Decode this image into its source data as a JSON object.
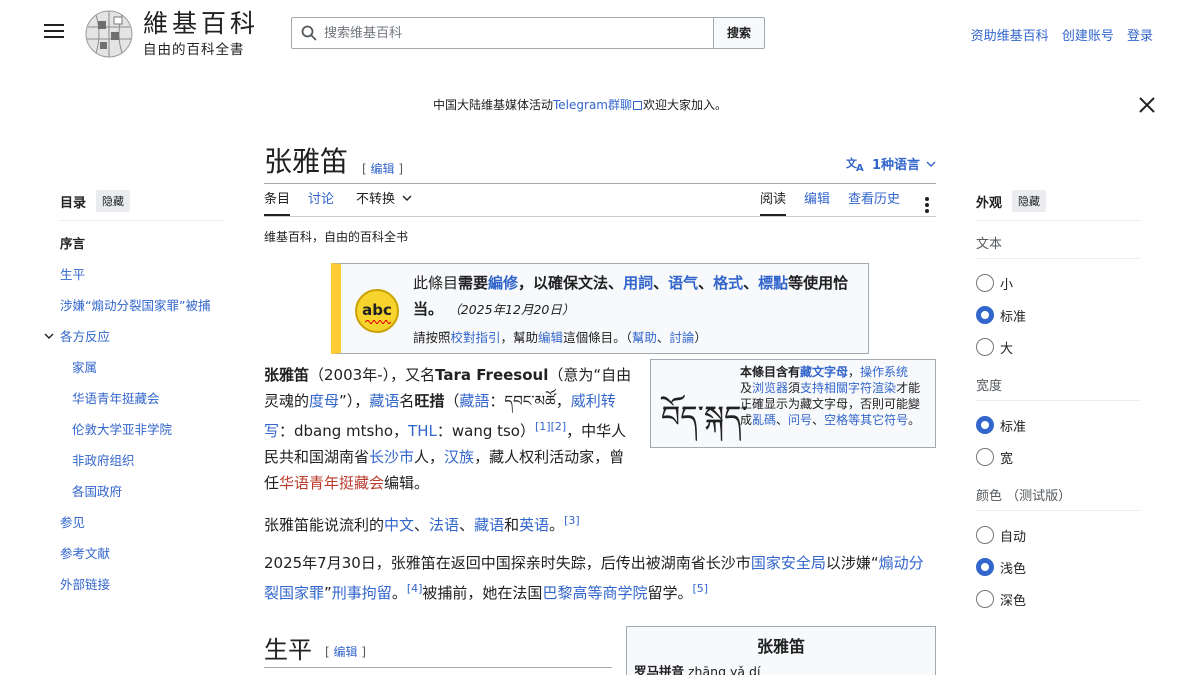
{
  "header": {
    "wordmark": "維基百科",
    "tagline": "自由的百科全書",
    "search_placeholder": "搜索维基百科",
    "search_button": "搜索",
    "user_links": [
      "资助维基百科",
      "创建账号",
      "登录"
    ]
  },
  "banner": {
    "prefix": "中国大陆维基媒体活动",
    "link": "Telegram群聊",
    "suffix": "欢迎大家加入。"
  },
  "toc": {
    "title": "目录",
    "hide": "隐藏",
    "items": [
      {
        "label": "序言"
      },
      {
        "label": "生平"
      },
      {
        "label": "涉嫌“煽动分裂国家罪”被捕"
      },
      {
        "label": "各方反应"
      },
      {
        "label": "家属"
      },
      {
        "label": "华语青年挺藏会"
      },
      {
        "label": "伦敦大学亚非学院"
      },
      {
        "label": "非政府组织"
      },
      {
        "label": "各国政府"
      },
      {
        "label": "参见"
      },
      {
        "label": "参考文献"
      },
      {
        "label": "外部链接"
      }
    ]
  },
  "article": {
    "title": "张雅笛",
    "edit": "编辑",
    "languages": "1种语言",
    "tabs_left": [
      "条目",
      "讨论",
      "不转换"
    ],
    "tabs_right": [
      "阅读",
      "编辑",
      "查看历史"
    ],
    "from": "维基百科，自由的百科全书",
    "ambox": {
      "p1": "此條目",
      "p2": "需要",
      "p3": "編修",
      "p4": "，以確保文法、",
      "p5": "用詞",
      "p6": "、",
      "p7": "语气",
      "p8": "、",
      "p9": "格式",
      "p10": "、",
      "p11": "標點",
      "p12": "等使用恰当。",
      "date": "（2025年12月20日）",
      "n1": "請按照",
      "n2": "校對指引",
      "n3": "，幫助",
      "n4": "编辑",
      "n5": "這個條目。（",
      "n6": "幫助",
      "n7": "、",
      "n8": "討論",
      "n9": "）"
    },
    "tibetan_box": {
      "glyph": "བོད་སྐད་",
      "t1": "本條目含有",
      "t2": "藏文字母",
      "t3": "，",
      "t4": "操作系统",
      "t5": "及",
      "t6": "浏览器",
      "t7": "須",
      "t8": "支持相關字符渲染",
      "t9": "才能正確显示为藏文字母，否則可能變成",
      "t10": "亂碼",
      "t11": "、",
      "t12": "问号",
      "t13": "、",
      "t14": "空格等其它符号",
      "t15": "。"
    },
    "lead": {
      "name": "张雅笛",
      "a1": "（2003年-），又名",
      "alias": "Tara Freesoul",
      "a2": "（意为“自由灵魂的",
      "a3": "度母",
      "a4": "”），",
      "a5": "藏语",
      "a6": "名",
      "a7": "旺措",
      "a8": "（",
      "a9": "藏語",
      "a10": "：",
      "tib": "དབང་མཚོ",
      "a11": "，",
      "a12": "威利转写",
      "a13": "：dbang mtsho，",
      "a14": "THL",
      "a15": "：wang tso）",
      "r1": "[1][2]",
      "a16": "，中华人民共和国湖南省",
      "a17": "长沙市",
      "a18": "人，",
      "a19": "汉族",
      "a20": "，藏人权利活动家，曾任",
      "a21": "华语青年挺藏会",
      "a22": "编辑。"
    },
    "para2": {
      "b1": "张雅笛能说流利的",
      "b2": "中文",
      "b3": "、",
      "b4": "法语",
      "b5": "、",
      "b6": "藏语",
      "b7": "和",
      "b8": "英语",
      "b9": "。",
      "r3": "[3]"
    },
    "para3": {
      "c1": "2025年7月30日，张雅笛在返回中国探亲时失踪，后传出被湖南省长沙市",
      "c2": "国家安全局",
      "c3": "以涉嫌“",
      "c4": "煽动分裂国家罪",
      "c5": "”",
      "c6": "刑事拘留",
      "c7": "。",
      "r4": "[4]",
      "c8": "被捕前，她在法国",
      "c9": "巴黎高等商学院",
      "c10": "留学。",
      "r5": "[5]"
    },
    "section": "生平",
    "section_edit": "编辑",
    "infobox": {
      "title": "张雅笛",
      "row_label": "罗马拼音",
      "row_value": "zhāng yǎ dí"
    }
  },
  "appearance": {
    "title": "外观",
    "hide": "隐藏",
    "groups": [
      {
        "title": "文本",
        "options": [
          "小",
          "标准",
          "大"
        ],
        "selected": 1
      },
      {
        "title": "宽度",
        "options": [
          "标准",
          "宽"
        ],
        "selected": 0
      },
      {
        "title": "颜色 （测试版）",
        "options": [
          "自动",
          "浅色",
          "深色"
        ],
        "selected": 1
      }
    ]
  },
  "colors": {
    "link": "#3366cc",
    "accent": "#36c",
    "ambox_bar": "#ffcc33",
    "redlink": "#ba3b2c"
  }
}
